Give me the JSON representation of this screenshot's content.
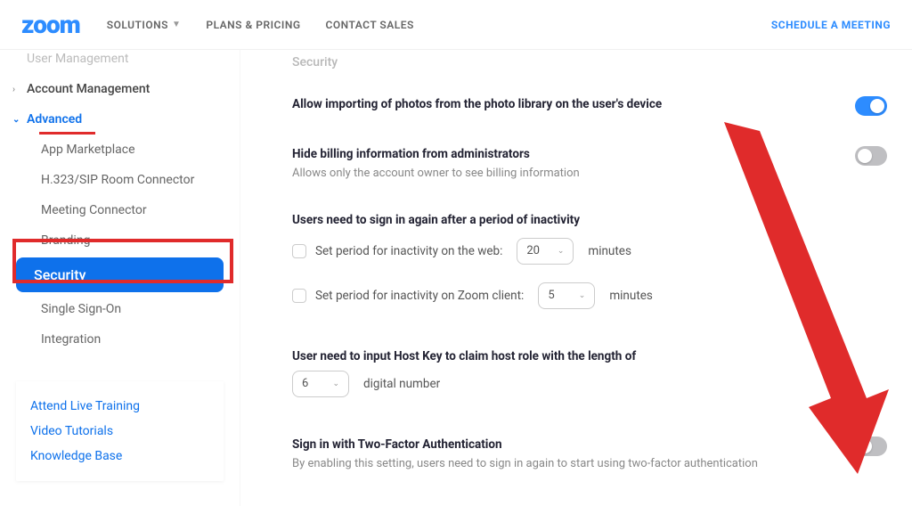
{
  "header": {
    "logo": "zoom",
    "nav": [
      "SOLUTIONS",
      "PLANS & PRICING",
      "CONTACT SALES"
    ],
    "cta": "SCHEDULE A MEETING"
  },
  "sidebar": {
    "top_faded": "User Management",
    "account_mgmt": "Account Management",
    "advanced": "Advanced",
    "subs": [
      "App Marketplace",
      "H.323/SIP Room Connector",
      "Meeting Connector",
      "Branding",
      "Security",
      "Single Sign-On",
      "Integration"
    ],
    "help": [
      "Attend Live Training",
      "Video Tutorials",
      "Knowledge Base"
    ]
  },
  "content": {
    "subtab_faint": "Security",
    "s1": {
      "title": "Allow importing of photos from the photo library on the user's device"
    },
    "s2": {
      "title": "Hide billing information from administrators",
      "desc": "Allows only the account owner to see billing information"
    },
    "s3": {
      "title": "Users need to sign in again after a period of inactivity",
      "row1_label": "Set period for inactivity on the web:",
      "row1_val": "20",
      "row1_unit": "minutes",
      "row2_label": "Set period for inactivity on Zoom client:",
      "row2_val": "5",
      "row2_unit": "minutes"
    },
    "s4": {
      "title": "User need to input Host Key to claim host role with the length of",
      "val": "6",
      "unit": "digital number"
    },
    "s5": {
      "title": "Sign in with Two-Factor Authentication",
      "desc": "By enabling this setting, users need to sign in again to start using two-factor authentication"
    }
  }
}
